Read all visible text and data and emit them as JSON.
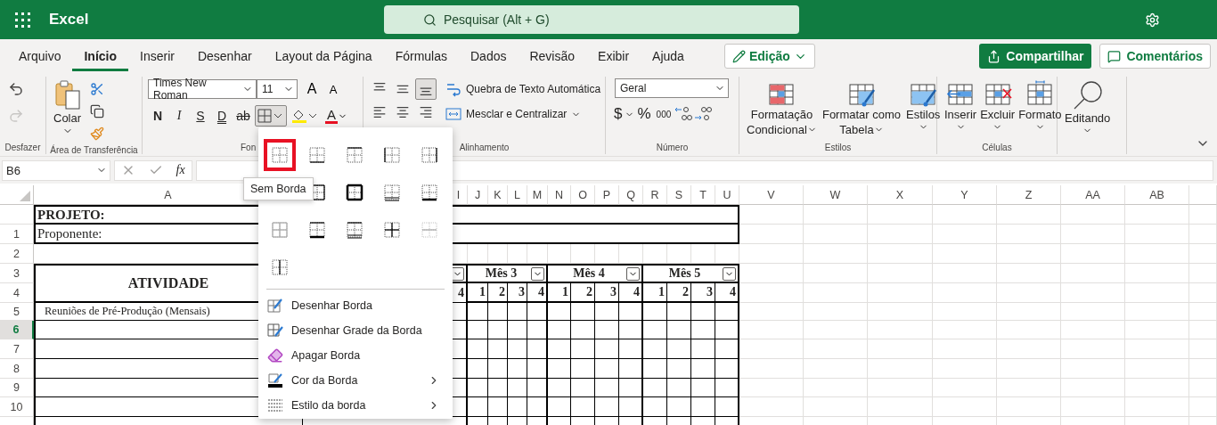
{
  "app_bar": {
    "app_name": "Excel",
    "search": {
      "placeholder": "Pesquisar (Alt + G)"
    }
  },
  "tabs": [
    {
      "label": "Arquivo",
      "selected": false
    },
    {
      "label": "Início",
      "selected": true
    },
    {
      "label": "Inserir",
      "selected": false
    },
    {
      "label": "Desenhar",
      "selected": false
    },
    {
      "label": "Layout da Página",
      "selected": false
    },
    {
      "label": "Fórmulas",
      "selected": false
    },
    {
      "label": "Dados",
      "selected": false
    },
    {
      "label": "Revisão",
      "selected": false
    },
    {
      "label": "Exibir",
      "selected": false
    },
    {
      "label": "Ajuda",
      "selected": false
    }
  ],
  "mode_button": {
    "label": "Edição"
  },
  "share_button": {
    "label": "Compartilhar"
  },
  "comments_button": {
    "label": "Comentários"
  },
  "ribbon": {
    "undo_group": {
      "label": "Desfazer",
      "items": [
        {
          "kind": "undo",
          "disabled": false
        },
        {
          "kind": "redo",
          "disabled": true
        }
      ]
    },
    "clipboard": {
      "label": "Área de Transferência",
      "paste": "Colar"
    },
    "font": {
      "label": "Fon",
      "font_name": "Times New Roman",
      "font_size": "11",
      "grow": "A",
      "shrink": "A",
      "font_color": "A",
      "styles": [
        {
          "kind": "bold",
          "text": "N"
        },
        {
          "kind": "italic",
          "text": "I"
        },
        {
          "kind": "underline",
          "text": "S"
        },
        {
          "kind": "double_underline",
          "text": "D"
        },
        {
          "kind": "strike",
          "text": "ab"
        }
      ],
      "borders_open": true
    },
    "alignment": {
      "label": "Alinhamento",
      "wrap": "Quebra de Texto Automática",
      "merge": "Mesclar e Centralizar",
      "align_buttons": [
        {
          "kind": "top",
          "selected": false
        },
        {
          "kind": "middle",
          "selected": false
        },
        {
          "kind": "bottom",
          "selected": true
        },
        {
          "kind": "left",
          "selected": false
        },
        {
          "kind": "center",
          "selected": false
        },
        {
          "kind": "right",
          "selected": false
        }
      ]
    },
    "number": {
      "label": "Número",
      "format": "Geral",
      "currency": "$",
      "percent": "%",
      "thousands": "000"
    },
    "styles": {
      "label": "Estilos",
      "buttons": [
        {
          "kind": "conditional",
          "lines": [
            "Formatação",
            "Condicional"
          ]
        },
        {
          "kind": "table",
          "lines": [
            "Formatar como",
            "Tabela"
          ]
        },
        {
          "kind": "styles",
          "lines": [
            "Estilos"
          ]
        }
      ]
    },
    "cells": {
      "label": "Células",
      "buttons": [
        {
          "kind": "insert",
          "label": "Inserir"
        },
        {
          "kind": "delete",
          "label": "Excluir"
        },
        {
          "kind": "format",
          "label": "Formato"
        }
      ]
    },
    "editing": {
      "label": "Editando"
    }
  },
  "formula_bar": {
    "name_box": "B6",
    "function_label": "fx"
  },
  "sheet": {
    "columns": [
      "A",
      "I",
      "J",
      "K",
      "L",
      "M",
      "N",
      "O",
      "P",
      "Q",
      "R",
      "S",
      "T",
      "U",
      "V",
      "W",
      "X",
      "Y",
      "Z",
      "AA",
      "AB"
    ],
    "rows": [
      {
        "selected": false
      },
      {
        "label": "1",
        "selected": false
      },
      {
        "label": "2",
        "selected": false
      },
      {
        "label": "3",
        "selected": false
      },
      {
        "label": "4",
        "selected": false
      },
      {
        "label": "5",
        "selected": false
      },
      {
        "label": "6",
        "selected": true
      },
      {
        "label": "7",
        "selected": false
      },
      {
        "label": "8",
        "selected": false
      },
      {
        "label": "9",
        "selected": false
      },
      {
        "label": "10",
        "selected": false
      },
      {
        "selected": false
      }
    ],
    "project_rows": [
      {
        "text": "PROJETO:",
        "bold": true
      },
      {
        "text": "Proponente:",
        "bold": false
      }
    ],
    "schedule": {
      "activity_header": "ATIVIDADE",
      "previous_month_last_week": "4",
      "months": [
        {
          "label": "Mês 3",
          "weeks": [
            "1",
            "2",
            "3",
            "4"
          ]
        },
        {
          "label": "Mês 4",
          "weeks": [
            "1",
            "2",
            "3",
            "4"
          ]
        },
        {
          "label": "Mês 5",
          "weeks": [
            "1",
            "2",
            "3",
            "4"
          ]
        }
      ],
      "activities": [
        {
          "name": "Reuniões de Pré-Produção (Mensais)"
        }
      ]
    }
  },
  "border_menu": {
    "tooltip": "Sem Borda",
    "option_rows": [
      [
        {
          "kind": "none",
          "selected": true,
          "disabled": false
        },
        {
          "kind": "bottom",
          "selected": false,
          "disabled": false
        },
        {
          "kind": "top",
          "selected": false,
          "disabled": false
        },
        {
          "kind": "left",
          "selected": false,
          "disabled": false
        },
        {
          "kind": "right",
          "selected": false,
          "disabled": false
        }
      ],
      [
        {
          "kind": "outside",
          "selected": false,
          "disabled": false
        },
        {
          "kind": "thick-outside",
          "selected": false,
          "disabled": false
        },
        {
          "kind": "double-bottom",
          "selected": false,
          "disabled": false
        },
        {
          "kind": "thick-bottom",
          "selected": false,
          "disabled": false
        }
      ],
      [
        {
          "kind": "all",
          "selected": false,
          "disabled": true
        },
        {
          "kind": "top-thick-bottom",
          "selected": false,
          "disabled": false
        },
        {
          "kind": "top-double-bottom",
          "selected": false,
          "disabled": false
        },
        {
          "kind": "inside",
          "selected": false,
          "disabled": false
        },
        {
          "kind": "inside-horizontal",
          "selected": false,
          "disabled": true
        }
      ],
      [
        {
          "kind": "inside-vertical",
          "selected": false,
          "disabled": false
        }
      ]
    ],
    "items": [
      {
        "kind": "draw",
        "label": "Desenhar Borda",
        "submenu": false
      },
      {
        "kind": "draw_grid",
        "label": "Desenhar Grade da Borda",
        "submenu": false
      },
      {
        "kind": "erase",
        "label": "Apagar Borda",
        "submenu": false
      },
      {
        "kind": "color",
        "label": "Cor da Borda",
        "submenu": true
      },
      {
        "kind": "style",
        "label": "Estilo da borda",
        "submenu": true
      }
    ]
  }
}
